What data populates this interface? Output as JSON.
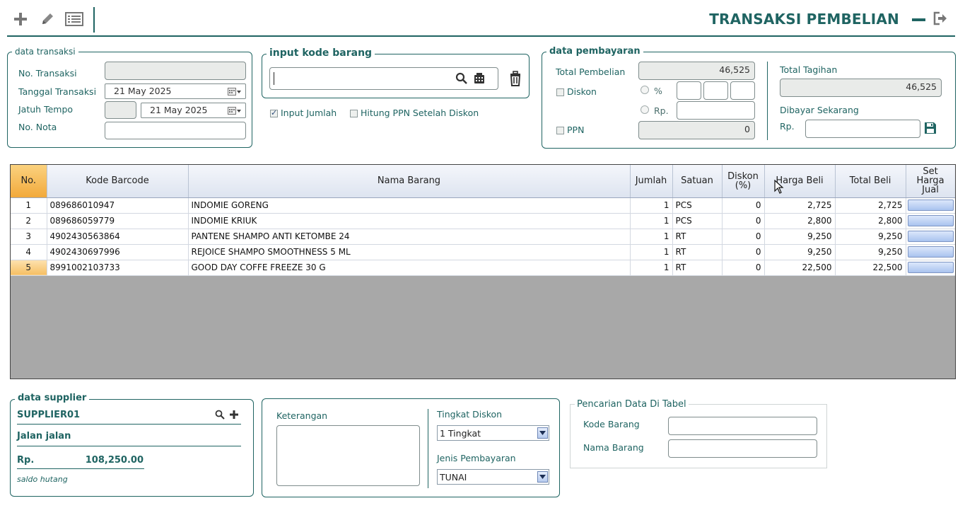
{
  "header": {
    "title": "TRANSAKSI PEMBELIAN",
    "toolbar": [
      "plus-icon",
      "pencil-icon",
      "list-icon"
    ],
    "window_controls": [
      "minimize-icon",
      "logout-icon"
    ]
  },
  "data_transaksi": {
    "legend": "data transaksi",
    "no_transaksi_label": "No. Transaksi",
    "no_transaksi_value": "",
    "tanggal_label": "Tanggal Transaksi",
    "tanggal_value": "21 May 2025",
    "jatuh_tempo_label": "Jatuh Tempo",
    "jatuh_tempo_days": "",
    "jatuh_tempo_value": "21 May 2025",
    "no_nota_label": "No. Nota",
    "no_nota_value": ""
  },
  "input_barang": {
    "legend": "input kode barang",
    "value": "",
    "input_jumlah_label": "Input Jumlah",
    "input_jumlah_checked": true,
    "hitung_ppn_label": "Hitung PPN Setelah Diskon",
    "hitung_ppn_checked": false
  },
  "pembayaran": {
    "legend": "data pembayaran",
    "total_pembelian_label": "Total Pembelian",
    "total_pembelian_value": "46,525",
    "diskon_label": "Diskon",
    "percent_label": "%",
    "rp_label": "Rp.",
    "ppn_label": "PPN",
    "ppn_value": "0",
    "total_tagihan_label": "Total Tagihan",
    "total_tagihan_value": "46,525",
    "dibayar_label": "Dibayar Sekarang",
    "dibayar_rp_label": "Rp.",
    "dibayar_value": ""
  },
  "table": {
    "headers": {
      "no": "No.",
      "barcode": "Kode Barcode",
      "nama": "Nama Barang",
      "jumlah": "Jumlah",
      "satuan": "Satuan",
      "diskon1": "Diskon",
      "diskon2": "(%)",
      "harga": "Harga Beli",
      "total": "Total Beli",
      "set1": "Set",
      "set2": "Harga",
      "set3": "Jual"
    },
    "rows": [
      {
        "no": "1",
        "barcode": "089686010947",
        "nama": "INDOMIE GORENG",
        "jumlah": "1",
        "satuan": "PCS",
        "diskon": "0",
        "harga": "2,725",
        "total": "2,725"
      },
      {
        "no": "2",
        "barcode": "089686059779",
        "nama": "INDOMIE KRIUK",
        "jumlah": "1",
        "satuan": "PCS",
        "diskon": "0",
        "harga": "2,800",
        "total": "2,800"
      },
      {
        "no": "3",
        "barcode": "4902430563864",
        "nama": "PANTENE SHAMPO ANTI KETOMBE 24",
        "jumlah": "1",
        "satuan": "RT",
        "diskon": "0",
        "harga": "9,250",
        "total": "9,250"
      },
      {
        "no": "4",
        "barcode": "4902430697996",
        "nama": "REJOICE SHAMPO SMOOTHNESS 5 ML",
        "jumlah": "1",
        "satuan": "RT",
        "diskon": "0",
        "harga": "9,250",
        "total": "9,250"
      },
      {
        "no": "5",
        "barcode": "8991002103733",
        "nama": "GOOD DAY  COFFE FREEZE 30 G",
        "jumlah": "1",
        "satuan": "RT",
        "diskon": "0",
        "harga": "22,500",
        "total": "22,500"
      }
    ],
    "selected_row": "5"
  },
  "supplier": {
    "legend": "data supplier",
    "name": "SUPPLIER01",
    "address": "Jalan jalan",
    "rp_label": "Rp.",
    "amount": "108,250.00",
    "saldo_label": "saldo hutang"
  },
  "keterangan": {
    "label": "Keterangan",
    "value": "",
    "tingkat_diskon_label": "Tingkat Diskon",
    "tingkat_diskon_value": "1 Tingkat",
    "jenis_pembayaran_label": "Jenis Pembayaran",
    "jenis_pembayaran_value": "TUNAI"
  },
  "pencarian": {
    "legend": "Pencarian Data Di Tabel",
    "kode_label": "Kode Barang",
    "kode_value": "",
    "nama_label": "Nama Barang",
    "nama_value": ""
  },
  "colors": {
    "accent": "#1f6462",
    "header_selected": "#f2a93b",
    "grid_empty": "#a8a8a8"
  }
}
